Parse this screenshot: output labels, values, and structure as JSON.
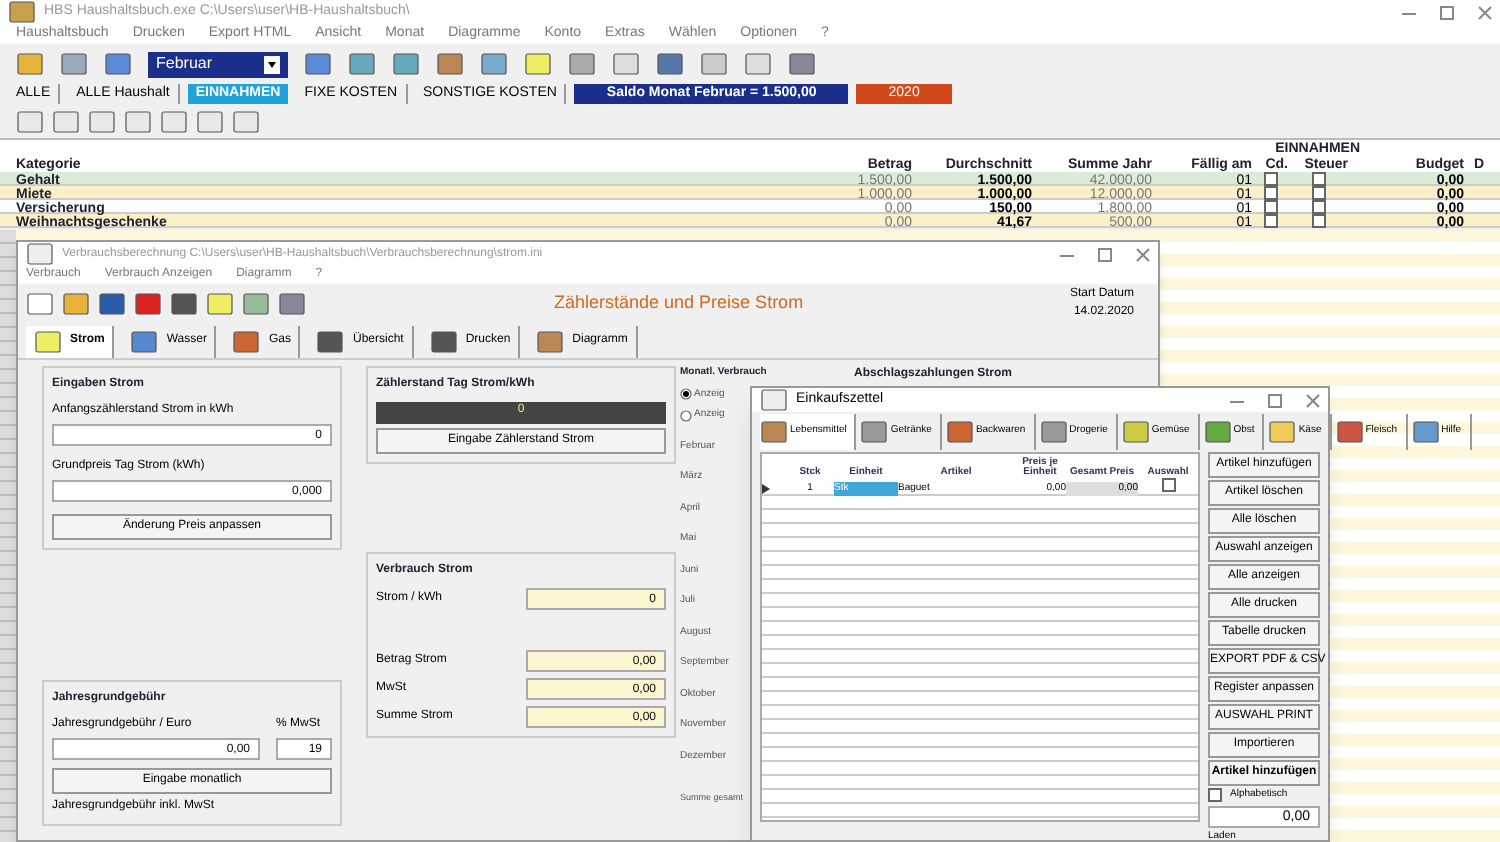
{
  "window": {
    "title": "HBS Haushaltsbuch.exe   C:\\Users\\user\\HB-Haushaltsbuch\\"
  },
  "menu": [
    "Haushaltsbuch",
    "Drucken",
    "Export HTML",
    "Ansicht",
    "Monat",
    "Diagramme",
    "Konto",
    "Extras",
    "Wählen",
    "Optionen",
    "?"
  ],
  "month_select": {
    "value": "Februar"
  },
  "categories": [
    {
      "label": "ALLE",
      "selected": false
    },
    {
      "label": "ALLE Haushalt",
      "selected": false
    },
    {
      "label": "EINNAHMEN",
      "selected": true
    },
    {
      "label": "FIXE KOSTEN",
      "selected": false
    },
    {
      "label": "SONSTIGE KOSTEN",
      "selected": false
    }
  ],
  "balance": "Saldo Monat Februar = 1.500,00",
  "year": "2020",
  "table": {
    "title": "EINNAHMEN",
    "columns": [
      "Kategorie",
      "Betrag",
      "Durchschnitt",
      "Summe Jahr",
      "Fällig am",
      "Cd.",
      "Steuer",
      "Budget",
      "D"
    ],
    "rows": [
      {
        "name": "Gehalt",
        "amount": "1.500,00",
        "average": "1.500,00",
        "year_sum": "42.000,00",
        "due": "01",
        "cd": false,
        "tax": false,
        "budget": "0,00",
        "color": "#dcebd8"
      },
      {
        "name": "Miete",
        "amount": "1.000,00",
        "average": "1.000,00",
        "year_sum": "12.000,00",
        "due": "01",
        "cd": false,
        "tax": false,
        "budget": "0,00",
        "color": "#fbf0c8"
      },
      {
        "name": "Versicherung",
        "amount": "0,00",
        "average": "150,00",
        "year_sum": "1.800,00",
        "due": "01",
        "cd": false,
        "tax": false,
        "budget": "0,00",
        "color": "#ffffff"
      },
      {
        "name": "Weihnachtsgeschenke",
        "amount": "0,00",
        "average": "41,67",
        "year_sum": "500,00",
        "due": "01",
        "cd": false,
        "tax": false,
        "budget": "0,00",
        "color": "#fbf0c8"
      }
    ]
  },
  "consumption_window": {
    "title": "Verbrauchsberechnung   C:\\Users\\user\\HB-Haushaltsbuch\\Verbrauchsberechnung\\strom.ini",
    "menu": [
      "Verbrauch",
      "Verbrauch Anzeigen",
      "Diagramm",
      "?"
    ],
    "heading": "Zählerstände und Preise Strom",
    "start_label": "Start Datum",
    "start_date": "14.02.2020",
    "tabs": [
      {
        "label": "Strom",
        "selected": true
      },
      {
        "label": "Wasser",
        "selected": false
      },
      {
        "label": "Gas",
        "selected": false
      },
      {
        "label": "Übersicht",
        "selected": false
      },
      {
        "label": "Drucken",
        "selected": false
      },
      {
        "label": "Diagramm",
        "selected": false
      }
    ],
    "input_group": {
      "title": "Eingaben Strom",
      "start_label": "Anfangszählerstand Strom in kWh",
      "start_value": "0",
      "price_label": "Grundpreis Tag Strom (kWh)",
      "price_value": "0,000",
      "button": "Änderung Preis anpassen"
    },
    "meter_group": {
      "title": "Zählerstand Tag Strom/kWh",
      "value": "0",
      "button": "Eingabe Zählerstand Strom"
    },
    "usage_group": {
      "title": "Verbrauch Strom",
      "fields": [
        {
          "label": "Strom / kWh",
          "value": "0"
        },
        {
          "label": "Betrag Strom",
          "value": "0,00"
        },
        {
          "label": "MwSt",
          "value": "0,00"
        },
        {
          "label": "Summe Strom",
          "value": "0,00"
        }
      ]
    },
    "fee_group": {
      "title": "Jahresgrundgebühr",
      "fee_label": "Jahresgrundgebühr / Euro",
      "fee_value": "0,00",
      "vat_label": "% MwSt",
      "vat_value": "19",
      "button": "Eingabe monatlich",
      "total_label": "Jahresgrundgebühr inkl. MwSt"
    },
    "monthly_group": {
      "title": "Monatl. Verbrauch",
      "options": [
        {
          "label": "Anzeig",
          "selected": true
        },
        {
          "label": "Anzeig",
          "selected": false
        }
      ],
      "months": [
        "Februar",
        "März",
        "April",
        "Mai",
        "Juni",
        "Juli",
        "August",
        "September",
        "Oktober",
        "November",
        "Dezember"
      ],
      "total_label": "Summe gesamt"
    },
    "payments_group": {
      "title": "Abschlagszahlungen Strom"
    }
  },
  "shopping_window": {
    "title": "Einkaufszettel",
    "tabs": [
      {
        "label": "Lebensmittel",
        "selected": true
      },
      {
        "label": "Getränke",
        "selected": false
      },
      {
        "label": "Backwaren",
        "selected": false
      },
      {
        "label": "Drogerie",
        "selected": false
      },
      {
        "label": "Gemüse",
        "selected": false
      },
      {
        "label": "Obst",
        "selected": false
      },
      {
        "label": "Käse",
        "selected": false
      },
      {
        "label": "Fleisch",
        "selected": false
      },
      {
        "label": "Hilfe",
        "selected": false
      }
    ],
    "columns": [
      "Stck",
      "Einheit",
      "Artikel",
      "Preis je Einheit",
      "Gesamt Preis",
      "Auswahl"
    ],
    "rows": [
      {
        "qty": "1",
        "unit": "Stk",
        "item": "Baguet",
        "price": "0,00",
        "total": "0,00",
        "checked": false
      }
    ],
    "buttons": [
      "Artikel hinzufügen",
      "Artikel löschen",
      "Alle löschen",
      "Auswahl anzeigen",
      "Alle anzeigen",
      "Alle drucken",
      "Tabelle drucken",
      "EXPORT PDF & CSV",
      "Register anpassen",
      "AUSWAHL PRINT",
      "Importieren",
      "Artikel hinzufügen"
    ],
    "alphabetical": {
      "label": "Alphabetisch",
      "checked": false
    },
    "sum": "0,00",
    "shop_label": "Laden"
  }
}
